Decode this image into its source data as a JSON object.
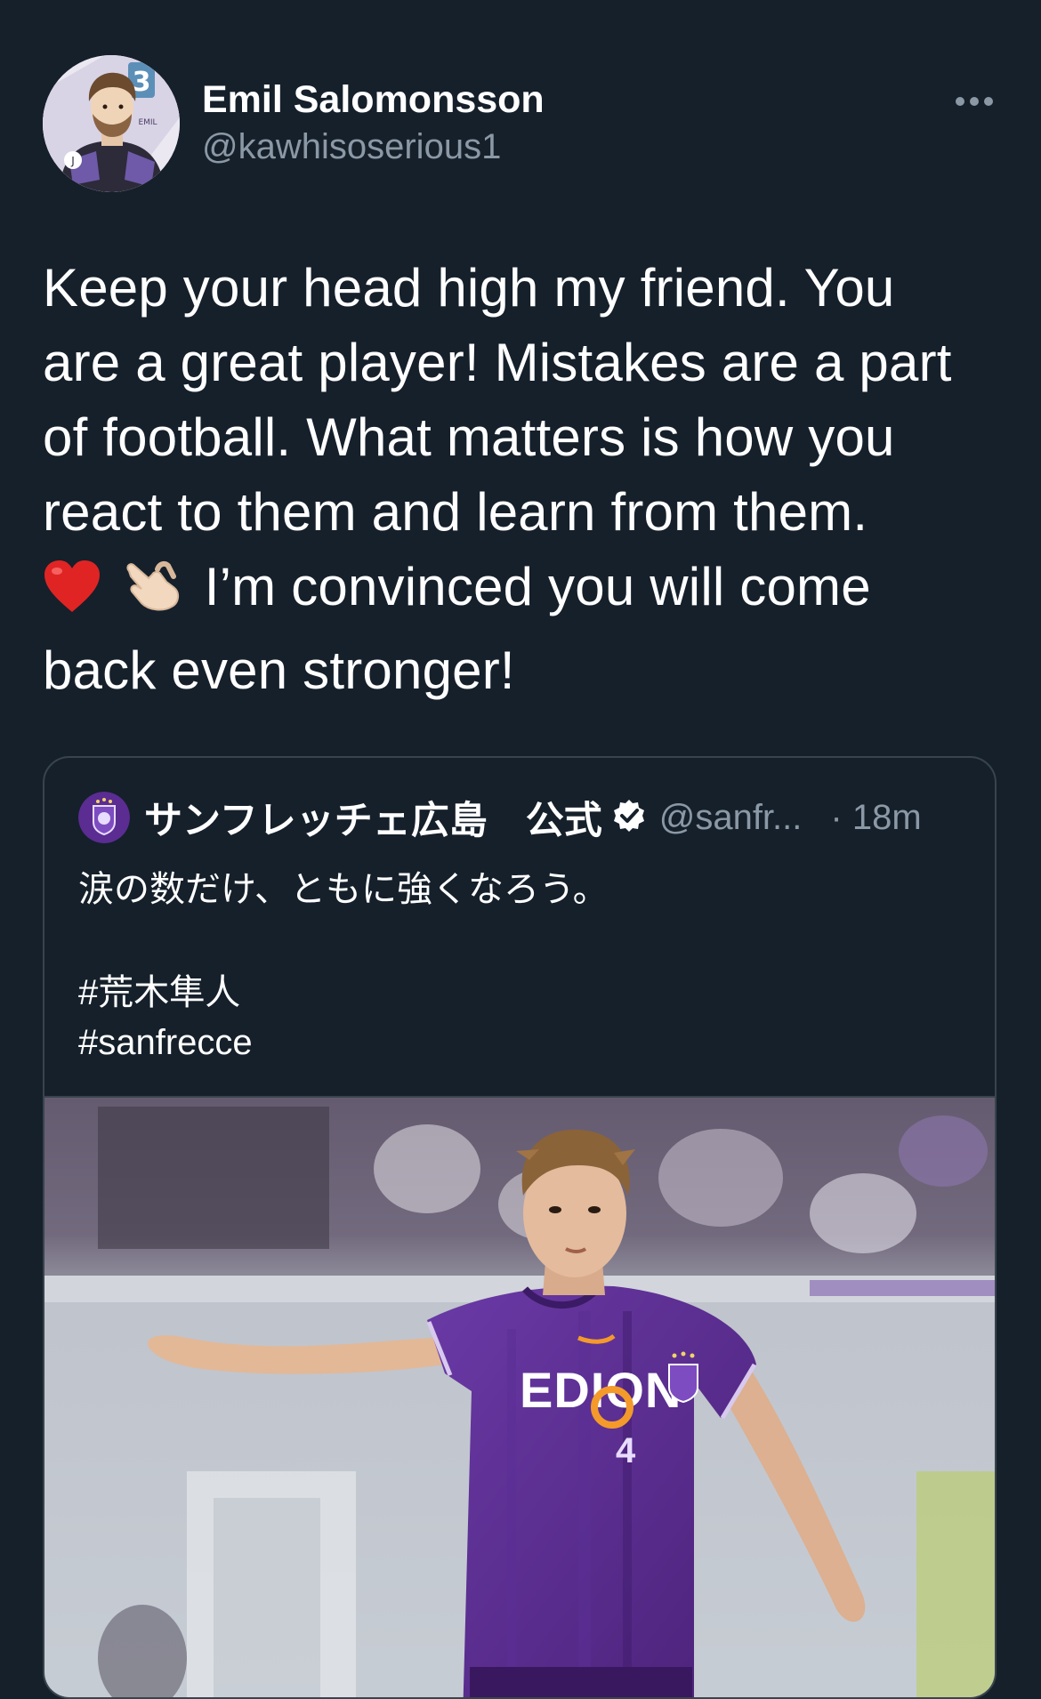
{
  "tweet": {
    "author": {
      "display_name": "Emil Salomonsson",
      "handle": "@kawhisoserious1",
      "avatar_icon": "avatar-illustration"
    },
    "more_icon": "more-options-icon",
    "text_lines": [
      "Keep your head high my friend. You",
      "are a great player! Mistakes are a part",
      "of football. What matters is how you",
      "react to them and learn from them.",
      "I’m convinced you will come",
      "back even stronger!"
    ],
    "emojis": [
      "red-heart-emoji",
      "call-me-hand-emoji"
    ]
  },
  "quoted_tweet": {
    "author": {
      "display_name": "サンフレッチェ広島　公式",
      "handle": "@sanfr...",
      "verified_icon": "verified-badge-icon",
      "avatar_icon": "club-crest-avatar"
    },
    "time": "· 18m",
    "text": {
      "line1": "涙の数だけ、ともに強くなろう。",
      "hashtag1": "#荒木隼人",
      "hashtag2": "#sanfrecce"
    },
    "media": {
      "description_icon": "football-player-photo",
      "shirt_sponsor": "EDION",
      "shirt_number": "4",
      "colors": {
        "kit": "#5b2c91",
        "pitch": "#c7cdd4",
        "crowd": "#6c6278"
      }
    }
  },
  "theme": {
    "background": "#15202b",
    "secondary_text": "#8b98a5",
    "border": "#38444d"
  }
}
